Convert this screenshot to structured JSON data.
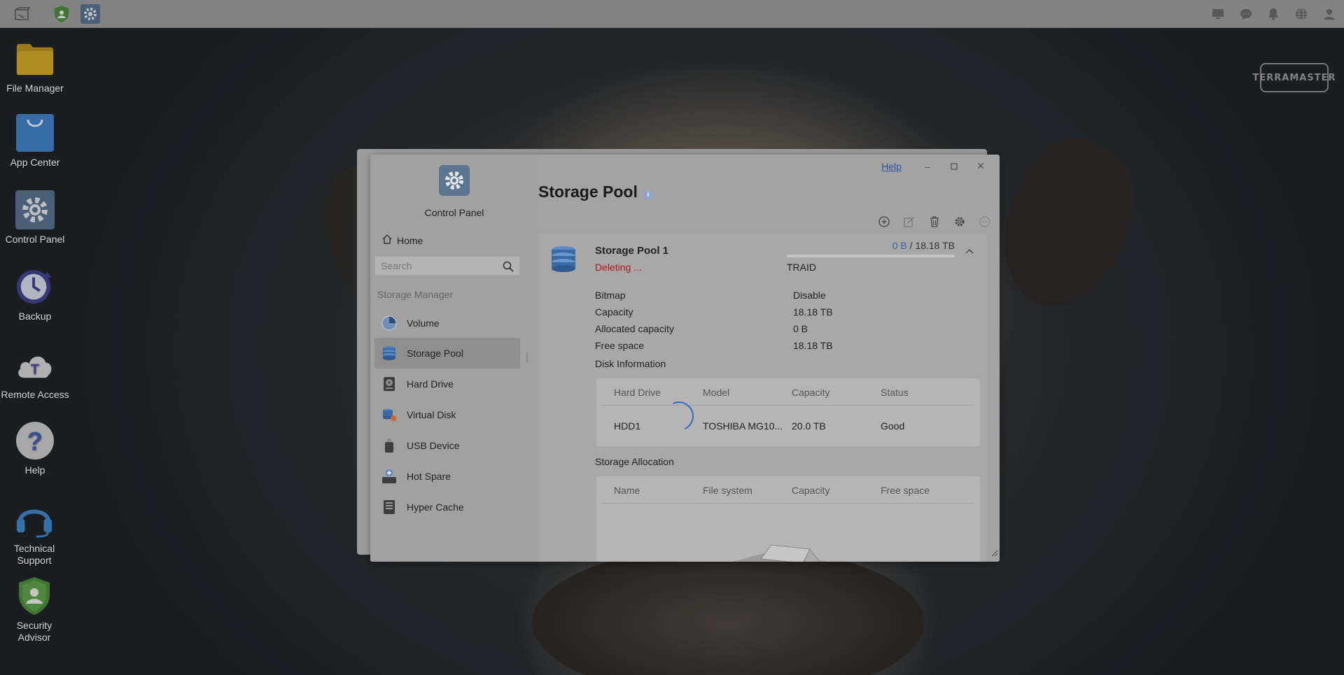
{
  "desktop": {
    "icons": [
      {
        "label": "File Manager",
        "icon": "folder-icon"
      },
      {
        "label": "App Center",
        "icon": "shopping-bag-icon"
      },
      {
        "label": "Control Panel",
        "icon": "gear-icon"
      },
      {
        "label": "Backup",
        "icon": "clock-icon"
      },
      {
        "label": "Remote Access",
        "icon": "cloud-icon"
      },
      {
        "label": "Help",
        "icon": "question-icon"
      },
      {
        "label": "Technical Support",
        "icon": "headset-icon"
      },
      {
        "label": "Security Advisor",
        "icon": "shield-icon"
      }
    ],
    "brand": "TERRAMASTER"
  },
  "window": {
    "help_label": "Help",
    "sidebar": {
      "title": "Control Panel",
      "home": "Home",
      "search_placeholder": "Search",
      "section": "Storage Manager",
      "items": [
        {
          "label": "Volume",
          "icon": "pie-icon"
        },
        {
          "label": "Storage Pool",
          "icon": "database-icon"
        },
        {
          "label": "Hard Drive",
          "icon": "hard-drive-icon"
        },
        {
          "label": "Virtual Disk",
          "icon": "virtual-disk-icon"
        },
        {
          "label": "USB Device",
          "icon": "usb-icon"
        },
        {
          "label": "Hot Spare",
          "icon": "hot-spare-icon"
        },
        {
          "label": "Hyper Cache",
          "icon": "cache-icon"
        }
      ]
    },
    "main": {
      "title": "Storage Pool",
      "pool": {
        "name": "Storage Pool 1",
        "status": "Deleting ...",
        "used": "0 B",
        "slash": "/",
        "total": "18.18 TB",
        "usage_fraction": 0,
        "raid": "TRAID",
        "properties": [
          {
            "key": "Bitmap",
            "value": "Disable"
          },
          {
            "key": "Capacity",
            "value": "18.18 TB"
          },
          {
            "key": "Allocated capacity",
            "value": "0 B"
          },
          {
            "key": "Free space",
            "value": "18.18 TB"
          }
        ],
        "disk_info_title": "Disk Information",
        "disk_table": {
          "headers": [
            "Hard Drive",
            "Model",
            "Capacity",
            "Status"
          ],
          "rows": [
            [
              "HDD1",
              "TOSHIBA MG10...",
              "20.0 TB",
              "Good"
            ]
          ]
        },
        "alloc_title": "Storage Allocation",
        "alloc_table": {
          "headers": [
            "Name",
            "File system",
            "Capacity",
            "Free space"
          ]
        }
      }
    }
  },
  "colors": {
    "accent": "#2b6cc4",
    "status_deleting": "#b0171a",
    "usage": "#3d5f9e"
  }
}
